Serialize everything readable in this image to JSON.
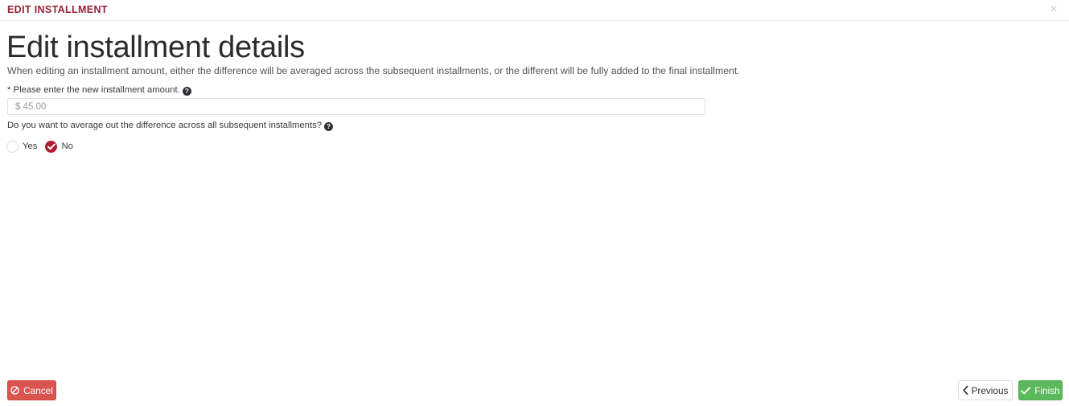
{
  "modal": {
    "header_title": "EDIT INSTALLMENT",
    "close_icon_label": "×",
    "accent_color": "#99203a"
  },
  "content": {
    "page_title": "Edit installment details",
    "description": "When editing an installment amount, either the difference will be averaged across the subsequent installments, or the different will be fully added to the final installment.",
    "amount_field": {
      "label": "* Please enter the new installment amount.",
      "help_glyph": "?",
      "value": "$ 45.00",
      "placeholder": "$ 45.00"
    },
    "average_question": {
      "label": "Do you want to average out the difference across all subsequent installments?",
      "help_glyph": "?",
      "options": [
        {
          "label": "Yes",
          "selected": false
        },
        {
          "label": "No",
          "selected": true
        }
      ],
      "selected_value": "No",
      "selected_color": "#b01c2e"
    }
  },
  "footer": {
    "cancel_label": "Cancel",
    "previous_label": "Previous",
    "finish_label": "Finish",
    "cancel_color": "#d9534f",
    "finish_color": "#5cb85c"
  }
}
